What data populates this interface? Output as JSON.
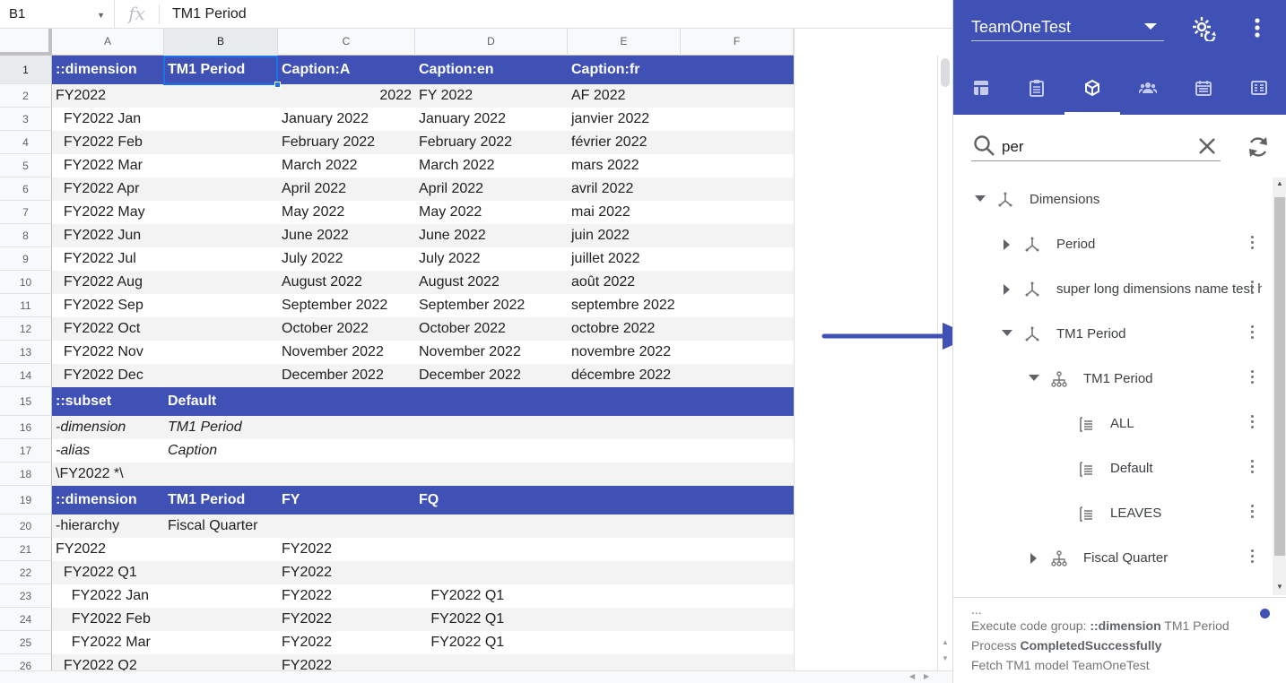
{
  "formula_bar": {
    "name_box": "B1",
    "fx": "fx",
    "value": "TM1 Period"
  },
  "columns": [
    "A",
    "B",
    "C",
    "D",
    "E",
    "F"
  ],
  "rows": [
    {
      "n": "1",
      "style": "head",
      "cells": [
        "::dimension",
        "TM1 Period",
        "Caption:A",
        "Caption:en",
        "Caption:fr"
      ]
    },
    {
      "n": "2",
      "style": "band",
      "cells": [
        "FY2022",
        "",
        "2022",
        "FY 2022",
        "AF 2022"
      ],
      "num_col": 2
    },
    {
      "n": "3",
      "style": "plain",
      "cells": [
        "  FY2022 Jan",
        "",
        "January 2022",
        "January 2022",
        "janvier 2022"
      ]
    },
    {
      "n": "4",
      "style": "band",
      "cells": [
        "  FY2022 Feb",
        "",
        "February 2022",
        "February 2022",
        "février 2022"
      ]
    },
    {
      "n": "5",
      "style": "plain",
      "cells": [
        "  FY2022 Mar",
        "",
        "March 2022",
        "March 2022",
        "mars 2022"
      ]
    },
    {
      "n": "6",
      "style": "band",
      "cells": [
        "  FY2022 Apr",
        "",
        "April 2022",
        "April 2022",
        "avril 2022"
      ]
    },
    {
      "n": "7",
      "style": "plain",
      "cells": [
        "  FY2022 May",
        "",
        "May 2022",
        "May 2022",
        "mai 2022"
      ]
    },
    {
      "n": "8",
      "style": "band",
      "cells": [
        "  FY2022 Jun",
        "",
        "June 2022",
        "June 2022",
        "juin 2022"
      ]
    },
    {
      "n": "9",
      "style": "plain",
      "cells": [
        "  FY2022 Jul",
        "",
        "July 2022",
        "July 2022",
        "juillet 2022"
      ]
    },
    {
      "n": "10",
      "style": "band",
      "cells": [
        "  FY2022 Aug",
        "",
        "August 2022",
        "August 2022",
        "août 2022"
      ]
    },
    {
      "n": "11",
      "style": "plain",
      "cells": [
        "  FY2022 Sep",
        "",
        "September 2022",
        "September 2022",
        "septembre 2022"
      ]
    },
    {
      "n": "12",
      "style": "band",
      "cells": [
        "  FY2022 Oct",
        "",
        "October 2022",
        "October 2022",
        "octobre 2022"
      ]
    },
    {
      "n": "13",
      "style": "plain",
      "cells": [
        "  FY2022 Nov",
        "",
        "November 2022",
        "November 2022",
        "novembre 2022"
      ]
    },
    {
      "n": "14",
      "style": "band",
      "cells": [
        "  FY2022 Dec",
        "",
        "December 2022",
        "December 2022",
        "décembre 2022"
      ]
    },
    {
      "n": "15",
      "style": "head",
      "cells": [
        "::subset",
        "Default",
        "",
        "",
        ""
      ]
    },
    {
      "n": "16",
      "style": "band",
      "italic": true,
      "cells": [
        "-dimension",
        "TM1 Period",
        "",
        "",
        ""
      ]
    },
    {
      "n": "17",
      "style": "plain",
      "italic": true,
      "cells": [
        "-alias",
        "Caption",
        "",
        "",
        ""
      ]
    },
    {
      "n": "18",
      "style": "band",
      "cells": [
        "\\FY2022 *\\",
        "",
        "",
        "",
        ""
      ]
    },
    {
      "n": "19",
      "style": "head",
      "cells": [
        "::dimension",
        "TM1 Period",
        "FY",
        "FQ",
        ""
      ]
    },
    {
      "n": "20",
      "style": "band",
      "cells": [
        "-hierarchy",
        "Fiscal Quarter",
        "",
        "",
        ""
      ]
    },
    {
      "n": "21",
      "style": "plain",
      "cells": [
        "FY2022",
        "",
        "FY2022",
        "",
        ""
      ]
    },
    {
      "n": "22",
      "style": "band",
      "cells": [
        "  FY2022 Q1",
        "",
        "FY2022",
        "",
        ""
      ]
    },
    {
      "n": "23",
      "style": "plain",
      "cells": [
        "    FY2022 Jan",
        "",
        "FY2022",
        "   FY2022 Q1",
        ""
      ]
    },
    {
      "n": "24",
      "style": "band",
      "cells": [
        "    FY2022 Feb",
        "",
        "FY2022",
        "   FY2022 Q1",
        ""
      ]
    },
    {
      "n": "25",
      "style": "plain",
      "cells": [
        "    FY2022 Mar",
        "",
        "FY2022",
        "   FY2022 Q1",
        ""
      ]
    },
    {
      "n": "26",
      "style": "band",
      "cells": [
        "  FY2022 Q2",
        "",
        "FY2022",
        "",
        ""
      ]
    }
  ],
  "panel": {
    "model_name": "TeamOneTest",
    "tabs": [
      "table-icon",
      "clipboard-list-icon",
      "cube-icon",
      "users-icon",
      "calendar-icon",
      "spreadsheet-icon"
    ],
    "search": {
      "value": "per"
    },
    "tree": [
      {
        "label": "Dimensions",
        "icon": "dimension-icon",
        "toggle": "down"
      },
      {
        "label": "Period",
        "icon": "dimension-icon",
        "toggle": "right"
      },
      {
        "label": "super long dimensions name test h",
        "icon": "dimension-icon",
        "toggle": "right"
      },
      {
        "label": "TM1 Period",
        "icon": "dimension-icon",
        "toggle": "down"
      },
      {
        "label": "TM1 Period",
        "icon": "hierarchy-icon",
        "toggle": "down"
      },
      {
        "label": "ALL",
        "icon": "subset-icon",
        "toggle": "none"
      },
      {
        "label": "Default",
        "icon": "subset-icon",
        "toggle": "none"
      },
      {
        "label": "LEAVES",
        "icon": "subset-icon",
        "toggle": "none"
      },
      {
        "label": "Fiscal Quarter",
        "icon": "hierarchy-icon",
        "toggle": "right"
      }
    ],
    "log": {
      "ellipsis": "...",
      "line1_prefix": "Execute code group: ",
      "line1_bold": "::dimension",
      "line1_suffix": " TM1 Period",
      "line2_prefix": "Process ",
      "line2_bold": "CompletedSuccessfully",
      "line3": "Fetch TM1 model TeamOneTest"
    },
    "accent_color": "#3f51b5"
  }
}
